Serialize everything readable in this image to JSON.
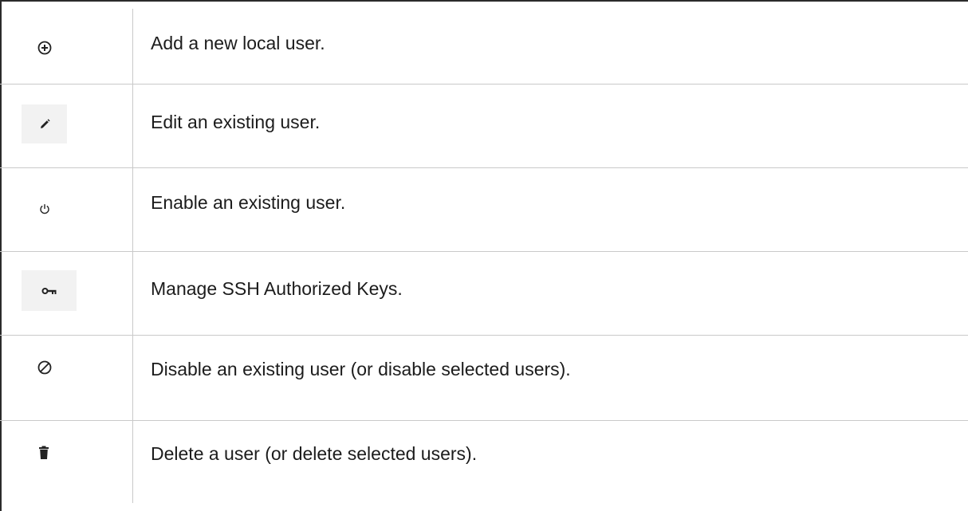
{
  "rows": [
    {
      "icon": "add-circle-icon",
      "description": "Add a new local user."
    },
    {
      "icon": "pencil-icon",
      "description": "Edit an existing user."
    },
    {
      "icon": "power-icon",
      "description": "Enable an existing user."
    },
    {
      "icon": "key-icon",
      "description": "Manage SSH Authorized Keys."
    },
    {
      "icon": "disable-icon",
      "description": "Disable an existing user (or disable selected users)."
    },
    {
      "icon": "trash-icon",
      "description": "Delete a user (or delete selected users)."
    }
  ],
  "colors": {
    "border_dark": "#2b2b2b",
    "grid_line": "#c9c9c9",
    "icon_background": "#f2f2f2",
    "text": "#1c1c1c"
  }
}
